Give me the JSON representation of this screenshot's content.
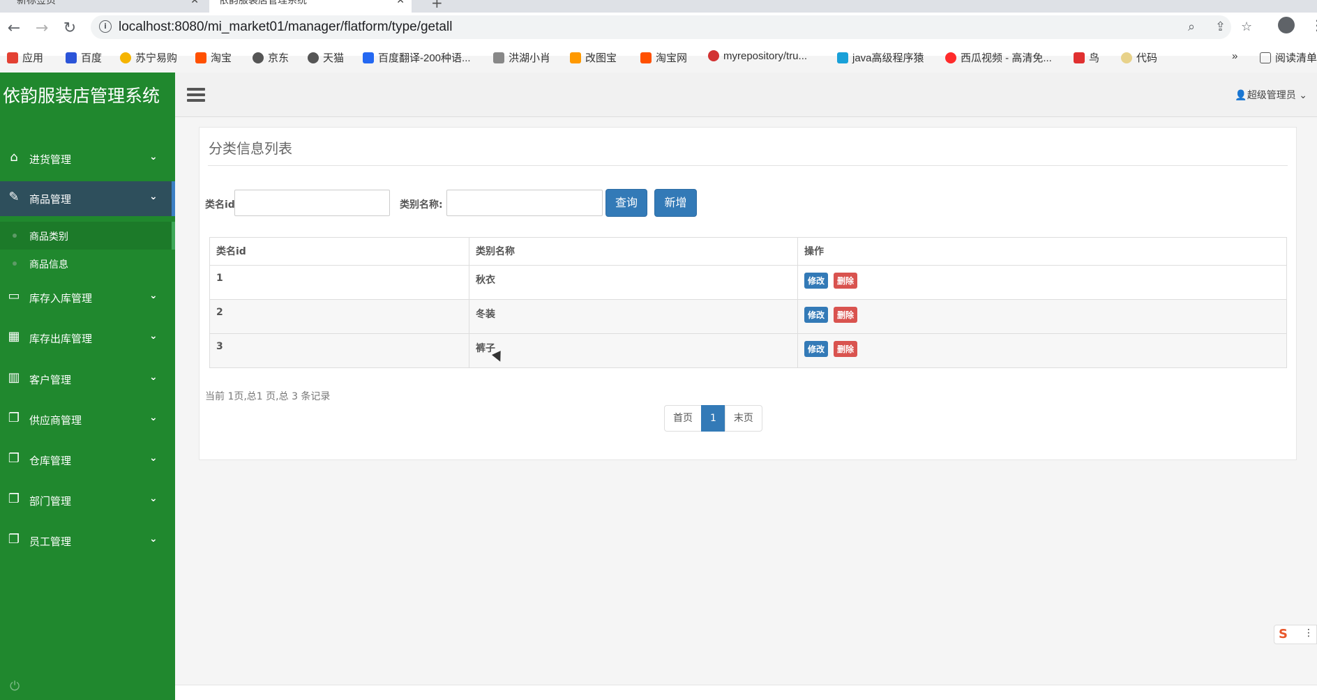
{
  "browser": {
    "tabs": [
      {
        "title": "新标签页"
      },
      {
        "title": "依韵服装店管理系统"
      }
    ],
    "url": "localhost:8080/mi_market01/manager/flatform/type/getall",
    "bookmarks": [
      {
        "label": "应用",
        "color": "#e34133"
      },
      {
        "label": "百度",
        "color": "#2b54d8"
      },
      {
        "label": "苏宁易购",
        "color": "#f5b400"
      },
      {
        "label": "淘宝",
        "color": "#ff5000"
      },
      {
        "label": "京东",
        "color": "#555555"
      },
      {
        "label": "天猫",
        "color": "#555555"
      },
      {
        "label": "百度翻译-200种语...",
        "color": "#2468f2"
      },
      {
        "label": "洪湖小肖",
        "color": "#888888"
      },
      {
        "label": "改图宝",
        "color": "#ff9900"
      },
      {
        "label": "淘宝网",
        "color": "#ff5000"
      },
      {
        "label": "myrepository/tru...",
        "color": "#d23232"
      },
      {
        "label": "java高级程序猿",
        "color": "#19a0d8"
      },
      {
        "label": "西瓜视频 - 高清免...",
        "color": "#ff2b2b"
      },
      {
        "label": "鸟",
        "color": "#e03030"
      },
      {
        "label": "代码",
        "color": "#e8d28a"
      },
      {
        "label": "阅读清单",
        "color": "#555555"
      }
    ],
    "more_bookmarks": "»"
  },
  "app": {
    "brand": "依韵服装店管理系统",
    "user": "超级管理员",
    "colors": {
      "sidebar": "#20882e",
      "primary": "#337ab7",
      "danger": "#d9534f"
    }
  },
  "sidebar": {
    "items": [
      {
        "label": "进货管理",
        "icon": "home-icon"
      },
      {
        "label": "商品管理",
        "icon": "edit-icon",
        "active": true
      },
      {
        "label": "库存入库管理",
        "icon": "monitor-icon"
      },
      {
        "label": "库存出库管理",
        "icon": "table-icon"
      },
      {
        "label": "客户管理",
        "icon": "bar-chart-icon"
      },
      {
        "label": "供应商管理",
        "icon": "copy-icon"
      },
      {
        "label": "仓库管理",
        "icon": "copy-icon"
      },
      {
        "label": "部门管理",
        "icon": "copy-icon"
      },
      {
        "label": "员工管理",
        "icon": "copy-icon"
      }
    ],
    "sub_items": [
      {
        "label": "商品类别",
        "active": true
      },
      {
        "label": "商品信息"
      }
    ]
  },
  "main": {
    "title": "分类信息列表",
    "search": {
      "id_label": "类名id:",
      "id_value": "",
      "name_label": "类别名称:",
      "name_value": "",
      "query_button": "查询",
      "add_button": "新增"
    },
    "table": {
      "headers": [
        "类名id",
        "类别名称",
        "操作"
      ],
      "rows": [
        {
          "id": "1",
          "name": "秋衣"
        },
        {
          "id": "2",
          "name": "冬装"
        },
        {
          "id": "3",
          "name": "裤子"
        }
      ],
      "edit_label": "修改",
      "delete_label": "删除"
    },
    "page_info": "当前 1页,总1 页,总 3 条记录",
    "pagination": {
      "first": "首页",
      "current": "1",
      "last": "末页"
    }
  }
}
